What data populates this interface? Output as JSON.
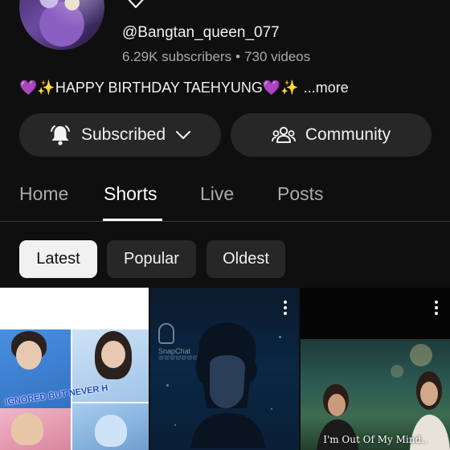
{
  "channel": {
    "handle": "@Bangtan_queen_077",
    "subscribers": "6.29K subscribers",
    "separator": "•",
    "videos": "730 videos",
    "description": "💜✨HAPPY BIRTHDAY TAEHYUNG💜✨",
    "more_label": "...more"
  },
  "actions": {
    "subscribed_label": "Subscribed",
    "community_label": "Community"
  },
  "tabs": [
    {
      "label": "Home"
    },
    {
      "label": "Shorts"
    },
    {
      "label": "Live"
    },
    {
      "label": "Posts"
    }
  ],
  "filters": [
    {
      "label": "Latest"
    },
    {
      "label": "Popular"
    },
    {
      "label": "Oldest"
    }
  ],
  "shorts": [
    {
      "overlay_text": "IGNORED BUT NEVER H"
    },
    {
      "watermark": "SnapChat",
      "watermark_sub": "@@@@@@@@@@@@"
    },
    {
      "caption": "I'm Out Of My Mind.."
    }
  ],
  "colors": {
    "background": "#0f0f0f",
    "button": "#272727",
    "text_primary": "#f1f1f1",
    "text_secondary": "#aaaaaa"
  },
  "icons": [
    "heart-outline-icon",
    "bell-icon",
    "chevron-down-icon",
    "community-icon",
    "more-vert-icon"
  ]
}
